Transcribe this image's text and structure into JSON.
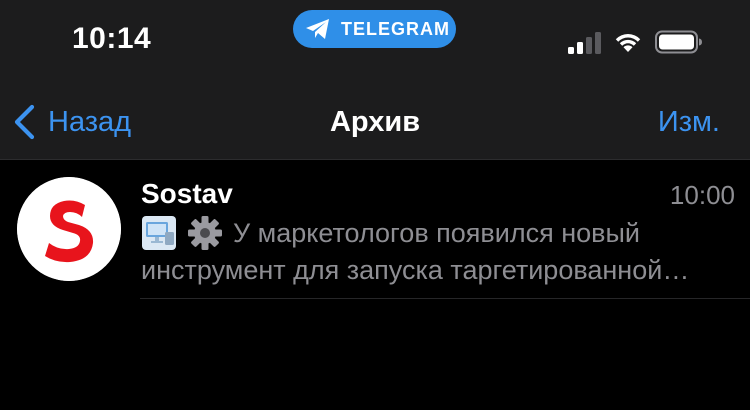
{
  "status_bar": {
    "time": "10:14",
    "app_pill": {
      "label": "TELEGRAM",
      "icon": "telegram-plane-icon",
      "color": "#2f8fe8"
    },
    "signal_icon": "cellular-signal-icon",
    "wifi_icon": "wifi-icon",
    "battery_icon": "battery-icon"
  },
  "nav": {
    "back_label": "Назад",
    "back_icon": "chevron-left-icon",
    "title": "Архив",
    "edit_label": "Изм.",
    "accent_color": "#3c93f0"
  },
  "chats": [
    {
      "name": "Sostav",
      "time": "10:00",
      "avatar_letter": "S",
      "avatar_icon": "sostav-logo-icon",
      "preview_icons": [
        "computer-screen-icon",
        "gear-icon"
      ],
      "preview_line1": "У маркетологов появился новый",
      "preview_line2": "инструмент для запуска таргетированной…"
    }
  ]
}
